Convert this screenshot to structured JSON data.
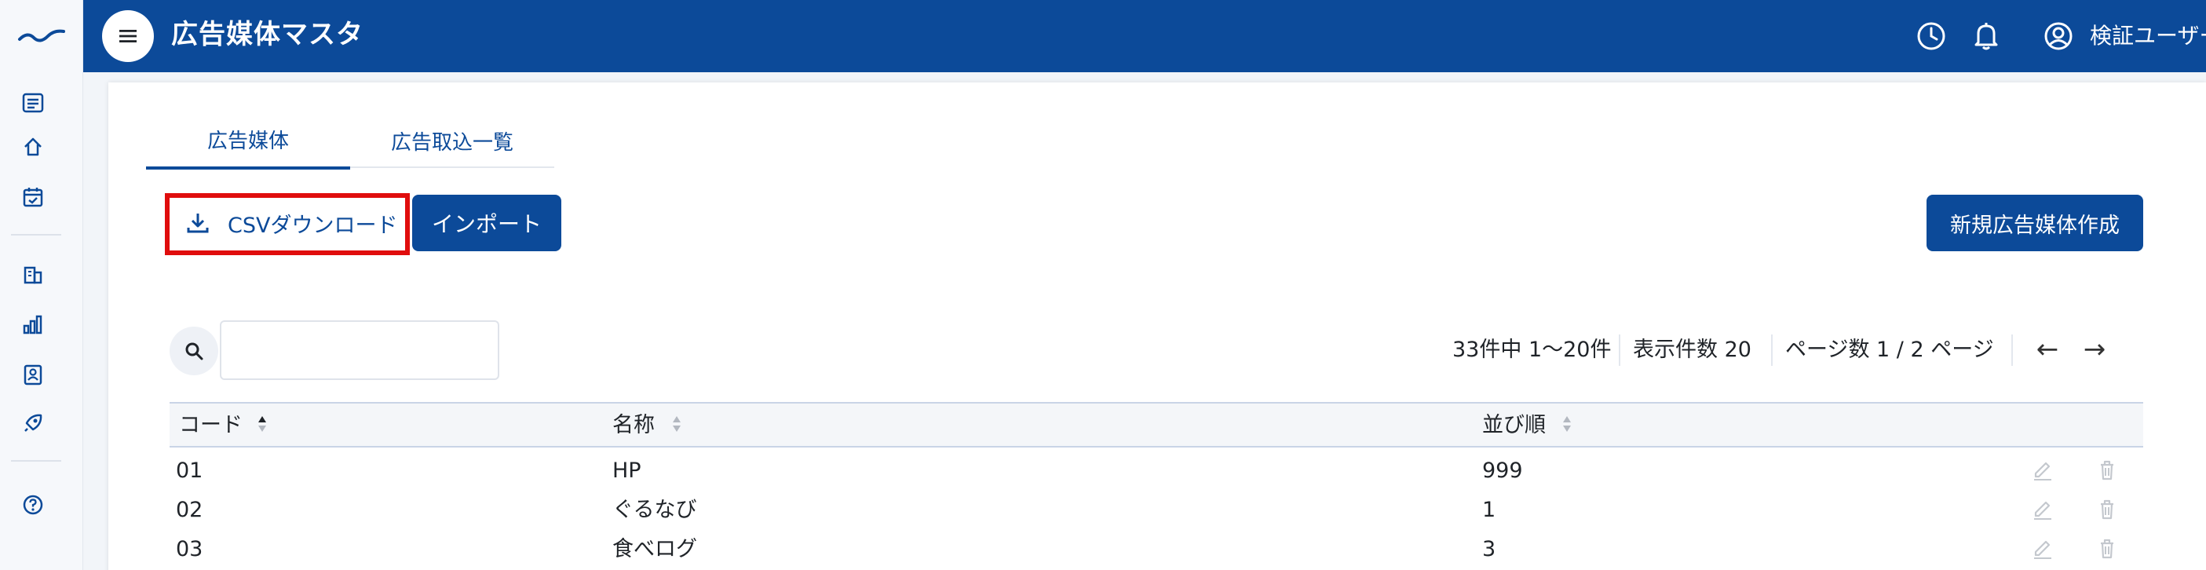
{
  "app": {
    "title": "広告媒体マスタ",
    "user": "検証ユーザー"
  },
  "sidebar": {
    "icons": [
      "logo-icon",
      "list-icon",
      "home-icon",
      "calendar-check-icon",
      "building-icon",
      "bar-chart-icon",
      "contact-card-icon",
      "rocket-icon",
      "help-icon"
    ]
  },
  "tabs": [
    {
      "label": "広告媒体",
      "active": true
    },
    {
      "label": "広告取込一覧",
      "active": false
    }
  ],
  "toolbar": {
    "csv_label": "CSVダウンロード",
    "import_label": "インポート",
    "new_label": "新規広告媒体作成"
  },
  "search": {
    "value": "",
    "placeholder": ""
  },
  "pagination": {
    "summary": "33件中 1〜20件",
    "page_size": "表示件数 20",
    "page_info": "ページ数 1 / 2 ページ",
    "prev": "←",
    "next": "→"
  },
  "table": {
    "columns": [
      "コード",
      "名称",
      "並び順"
    ],
    "rows": [
      {
        "code": "01",
        "name": "HP",
        "order": "999"
      },
      {
        "code": "02",
        "name": "ぐるなび",
        "order": "1"
      },
      {
        "code": "03",
        "name": "食べログ",
        "order": "3"
      }
    ]
  },
  "colors": {
    "primary": "#0c4a99",
    "highlight": "#e00d0d"
  }
}
